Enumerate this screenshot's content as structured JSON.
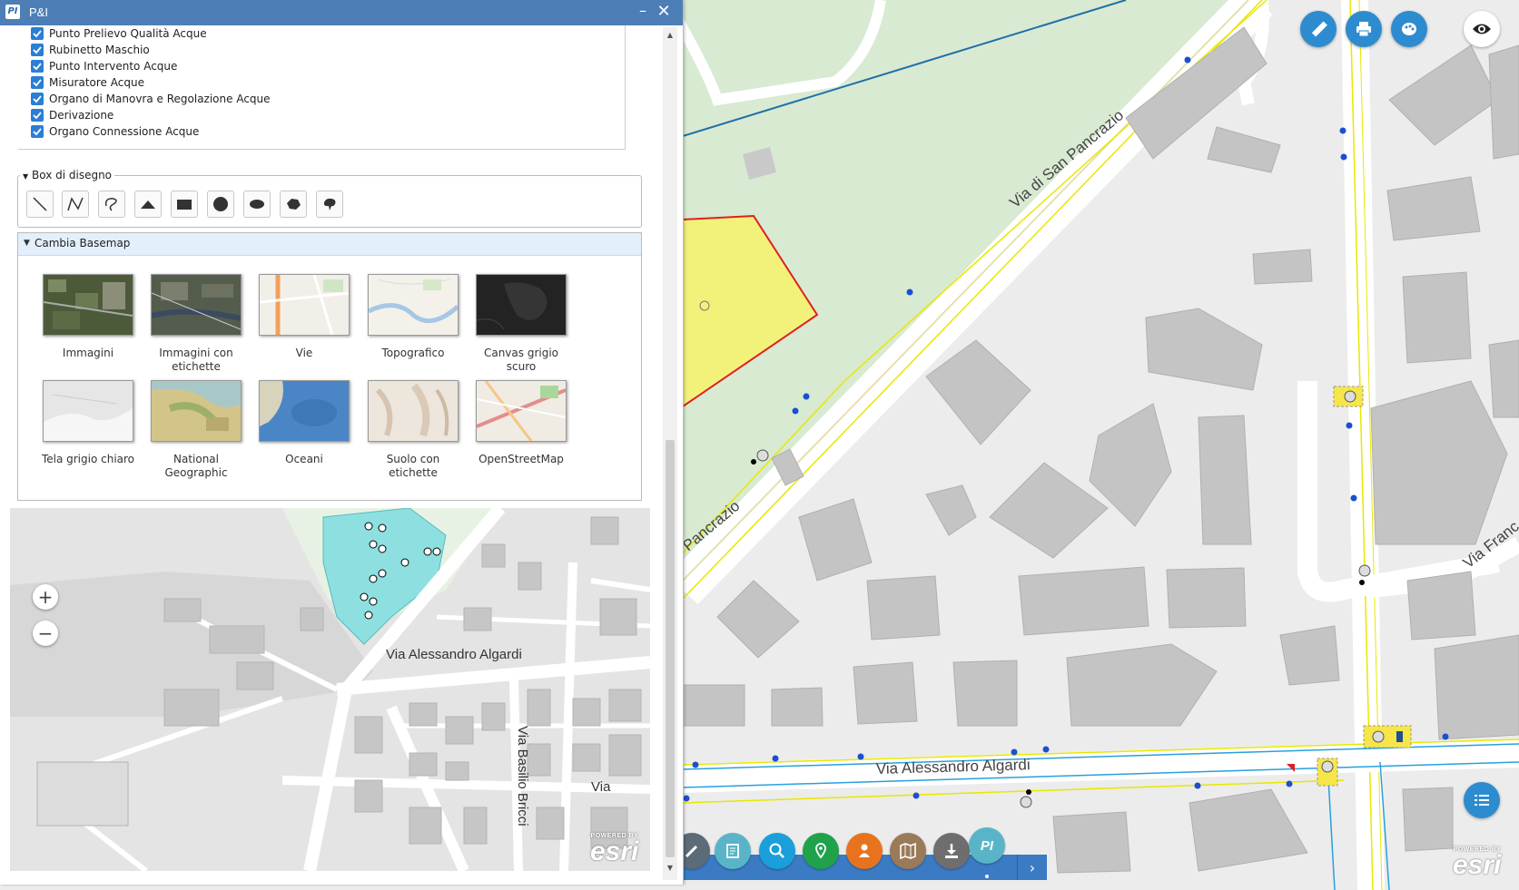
{
  "panel": {
    "title": "P&I",
    "logo_text": "PI",
    "minimize_symbol": "–",
    "close_symbol": "✕",
    "layers": [
      {
        "label": "Punto Prelievo Qualità Acque",
        "checked": true
      },
      {
        "label": "Rubinetto Maschio",
        "checked": true
      },
      {
        "label": "Punto Intervento Acque",
        "checked": true
      },
      {
        "label": "Misuratore Acque",
        "checked": true
      },
      {
        "label": "Organo di Manovra e Regolazione Acque",
        "checked": true
      },
      {
        "label": "Derivazione",
        "checked": true
      },
      {
        "label": "Organo Connessione Acque",
        "checked": true
      }
    ],
    "draw_box": {
      "legend": "Box di disegno",
      "tools": [
        "line-tool-icon",
        "polyline-tool-icon",
        "freehand-line-icon",
        "triangle-tool-icon",
        "rectangle-tool-icon",
        "circle-tool-icon",
        "ellipse-tool-icon",
        "polygon-tool-icon",
        "freehand-polygon-icon"
      ]
    },
    "basemap": {
      "header": "Cambia Basemap",
      "items": [
        {
          "label": "Immagini"
        },
        {
          "label": "Immagini con etichette"
        },
        {
          "label": "Vie"
        },
        {
          "label": "Topografico"
        },
        {
          "label": "Canvas grigio scuro"
        },
        {
          "label": "Tela grigio chiaro"
        },
        {
          "label": "National Geographic"
        },
        {
          "label": "Oceani"
        },
        {
          "label": "Suolo con etichette"
        },
        {
          "label": "OpenStreetMap"
        }
      ]
    },
    "overview": {
      "zoom_in": "+",
      "zoom_out": "−",
      "streets": [
        "Via Alessandro Algardi",
        "Via Basilio Bricci",
        "Via"
      ]
    }
  },
  "map": {
    "streets": [
      "Via di San Pancrazio",
      "Pancrazio",
      "Via Alessandro Algardi",
      "Via Franc"
    ],
    "toolbar": [
      "ruler-icon",
      "printer-icon",
      "basemap-palette-icon",
      "eye-icon"
    ],
    "layerlist_icon": "layer-list-icon"
  },
  "dock": {
    "items": [
      "tools-icon",
      "identify-icon",
      "search-icon",
      "location-icon",
      "user-icon",
      "map-icon",
      "download-icon",
      "pi-icon"
    ],
    "active_logo_text": "PI",
    "next_symbol": "›"
  },
  "attribution": {
    "powered": "POWERED BY",
    "brand": "esri"
  },
  "colors": {
    "titlebar": "#4d7eb6",
    "accent": "#2d8ccf",
    "checkbox": "#2a7fd4",
    "dock_bar": "#3a7bc3"
  }
}
